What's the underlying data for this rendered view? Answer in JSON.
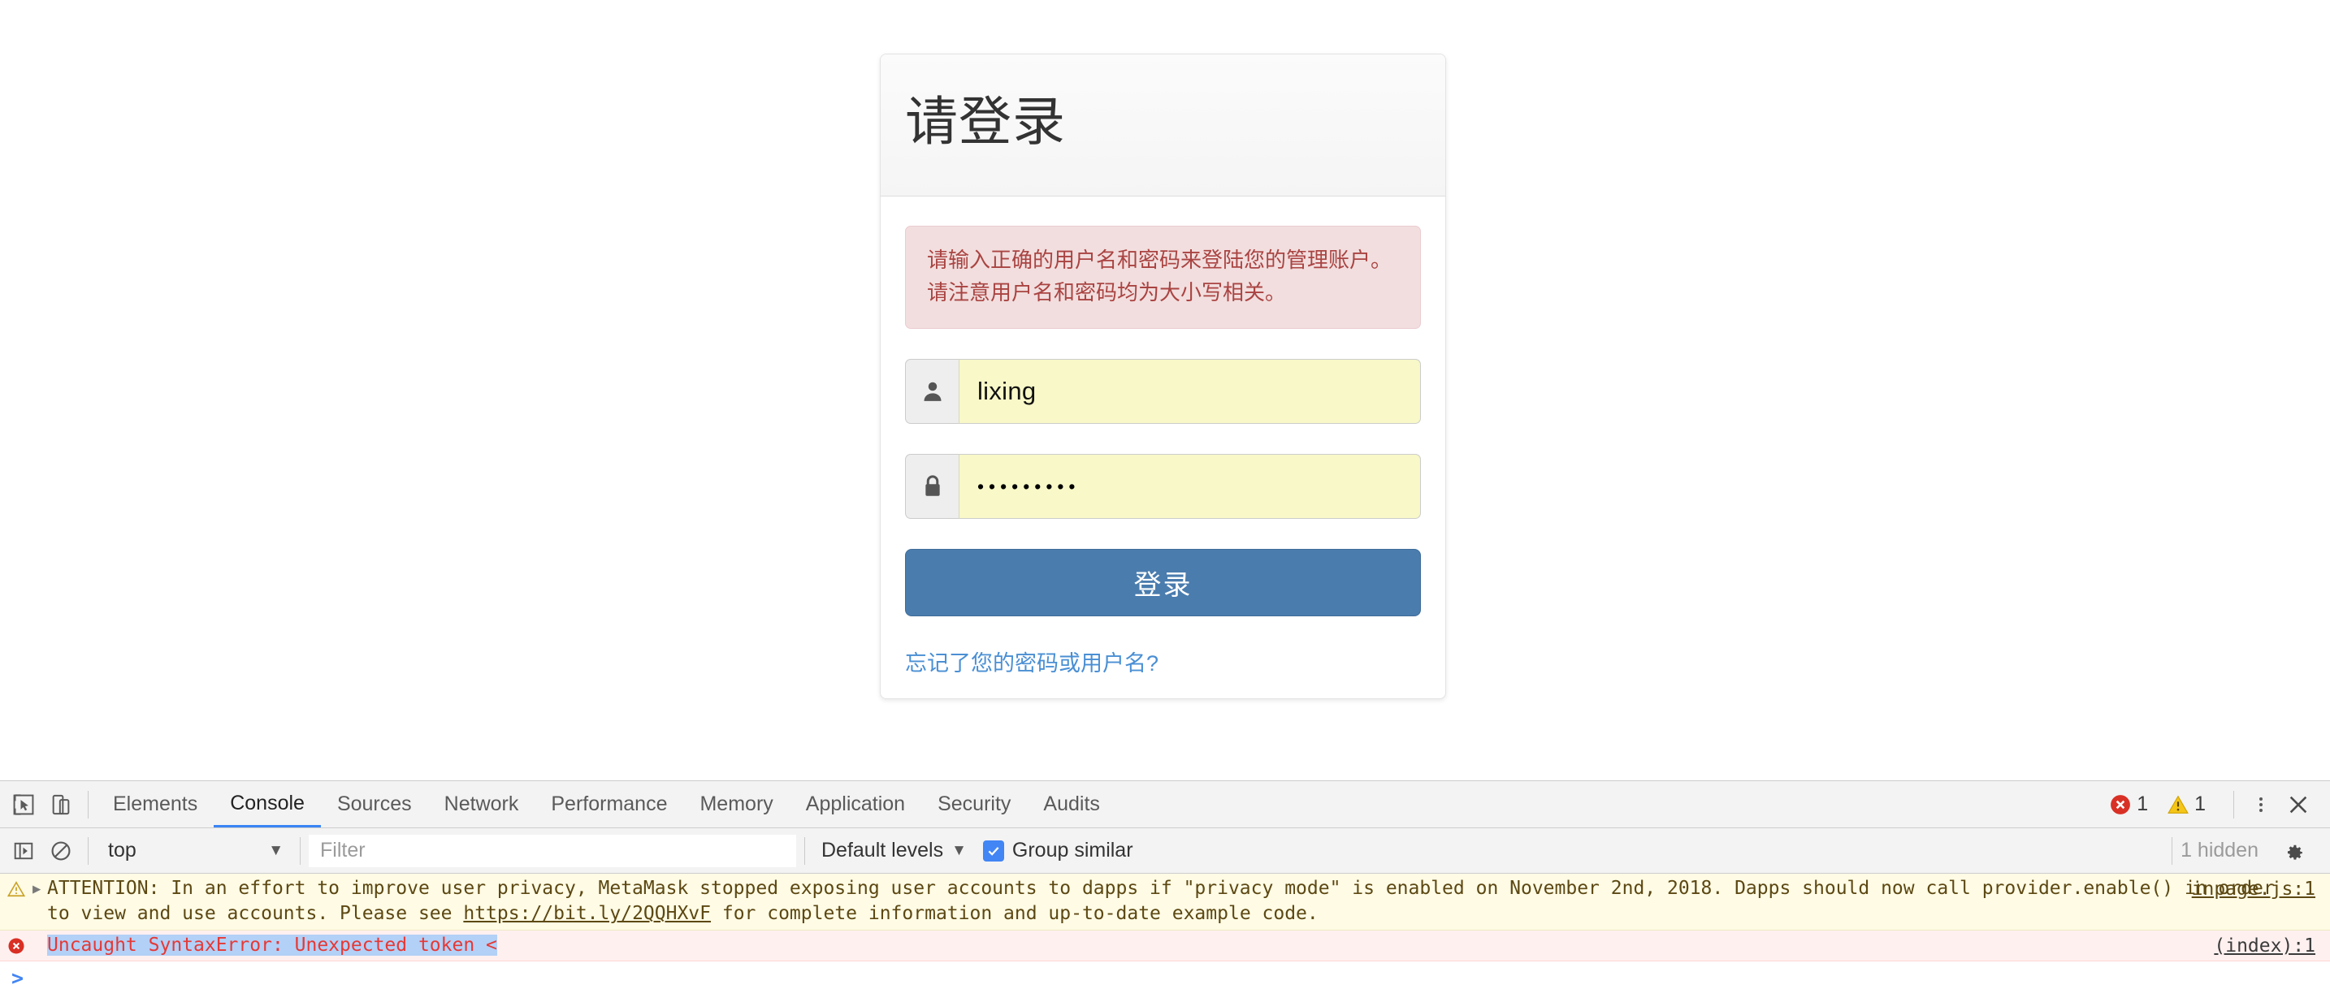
{
  "page": {
    "login": {
      "title": "请登录",
      "alert_text": "请输入正确的用户名和密码来登陆您的管理账户。请注意用户名和密码均为大小写相关。",
      "username_value": "lixing",
      "username_icon": "user-icon",
      "password_value": "•••••••••",
      "password_icon": "lock-icon",
      "submit_label": "登录",
      "forgot_link_label": "忘记了您的密码或用户名?",
      "colors": {
        "button": "#4a7cae",
        "alert_bg": "#f2dede",
        "alert_border": "#ebccd1",
        "alert_text": "#a94442",
        "autofill_bg": "#f8f8c8",
        "link": "#4a8fd4"
      }
    }
  },
  "devtools": {
    "tools": {
      "inspect_icon": "cursor-inspect-icon",
      "device_toolbar_icon": "device-toolbar-icon"
    },
    "tabs": [
      {
        "label": "Elements",
        "active": false
      },
      {
        "label": "Console",
        "active": true
      },
      {
        "label": "Sources",
        "active": false
      },
      {
        "label": "Network",
        "active": false
      },
      {
        "label": "Performance",
        "active": false
      },
      {
        "label": "Memory",
        "active": false
      },
      {
        "label": "Application",
        "active": false
      },
      {
        "label": "Security",
        "active": false
      },
      {
        "label": "Audits",
        "active": false
      }
    ],
    "status": {
      "error_count": "1",
      "warning_count": "1",
      "more_icon": "kebab-menu-icon",
      "close_icon": "close-icon"
    },
    "console_toolbar": {
      "sidebar_icon": "console-sidebar-icon",
      "clear_icon": "clear-console-icon",
      "context_value": "top",
      "filter_placeholder": "Filter",
      "filter_value": "",
      "levels_value": "Default levels",
      "group_similar_label": "Group similar",
      "group_similar_checked": true,
      "hidden_label": "1 hidden",
      "settings_icon": "gear-icon"
    },
    "messages": [
      {
        "level": "warning",
        "icon": "warning-triangle-icon",
        "expandable": true,
        "text_before_link": "ATTENTION: In an effort to improve user privacy, MetaMask stopped exposing user accounts to dapps if \"privacy mode\" is enabled on November 2nd, 2018. Dapps should now call provider.enable() in order to view and use accounts. Please see ",
        "link_text": "https://bit.ly/2QQHXvF",
        "text_after_link": " for complete information and up-to-date example code.",
        "source": "inpage.js:1"
      },
      {
        "level": "error",
        "icon": "error-circle-icon",
        "expandable": false,
        "text_before_link": "Uncaught SyntaxError: Unexpected token <",
        "link_text": "",
        "text_after_link": "",
        "source": "(index):1"
      }
    ],
    "prompt": {
      "chevron": ">",
      "input_value": ""
    }
  }
}
